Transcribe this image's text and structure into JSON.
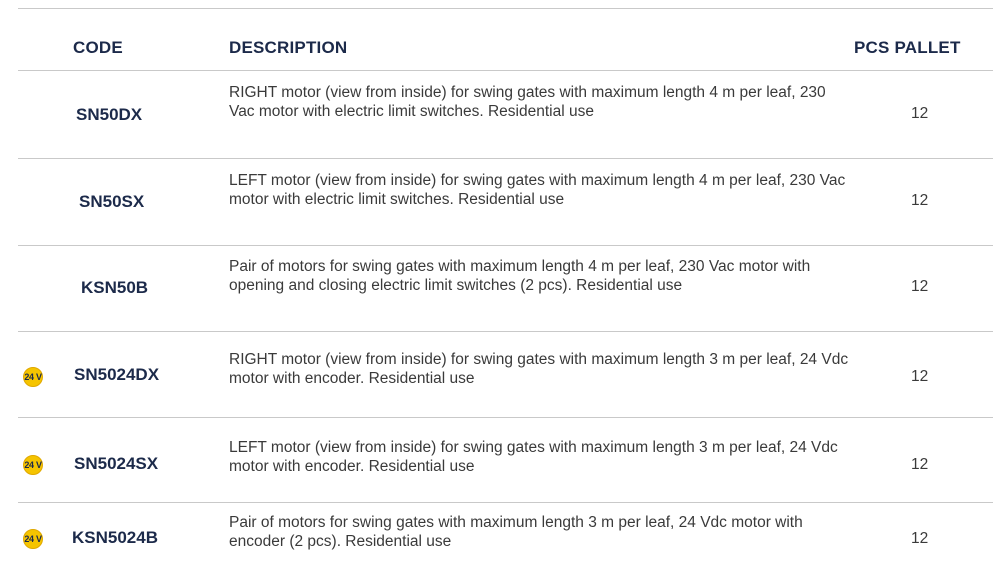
{
  "header": {
    "code": "CODE",
    "description": "DESCRIPTION",
    "pcs_pallet": "PCS PALLET"
  },
  "rows": [
    {
      "badge": "",
      "code": "SN50DX",
      "description": "RIGHT motor (view from inside) for swing gates with maximum length 4 m per leaf, 230 Vac motor with electric limit switches. Residential use",
      "pcs": "12"
    },
    {
      "badge": "",
      "code": "SN50SX",
      "description": "LEFT motor (view from inside) for swing gates with maximum length 4 m per leaf, 230 Vac motor with electric limit switches. Residential use",
      "pcs": "12"
    },
    {
      "badge": "",
      "code": "KSN50B",
      "description": "Pair of motors for swing gates with maximum length 4 m per leaf, 230 Vac motor with opening and closing electric limit switches (2 pcs). Residential use",
      "pcs": "12"
    },
    {
      "badge": "24 V",
      "code": "SN5024DX",
      "description": "RIGHT motor (view from inside) for swing gates with maximum length 3 m per leaf, 24 Vdc motor with encoder. Residential use",
      "pcs": "12"
    },
    {
      "badge": "24 V",
      "code": "SN5024SX",
      "description": "LEFT motor (view from inside) for swing gates with maximum length 3 m per leaf, 24 Vdc motor with encoder. Residential use",
      "pcs": "12"
    },
    {
      "badge": "24 V",
      "code": "KSN5024B",
      "description": "Pair of motors for swing gates with maximum length 3 m per leaf, 24 Vdc motor with encoder (2 pcs). Residential use",
      "pcs": "12"
    }
  ],
  "colors": {
    "heading": "#1c2a4a",
    "text": "#3a3a3a",
    "rule": "#c9c9c9",
    "badge_fill": "#f5c400"
  }
}
